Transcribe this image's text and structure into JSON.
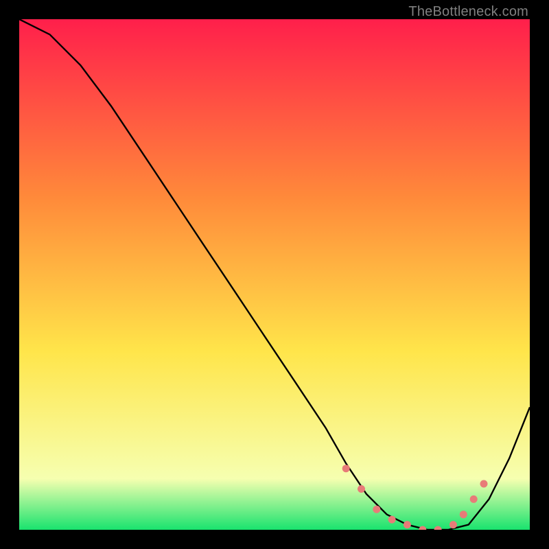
{
  "attribution": "TheBottleneck.com",
  "colors": {
    "gradient_top": "#ff1f4b",
    "gradient_mid_high": "#ff8a3a",
    "gradient_mid": "#ffe54a",
    "gradient_low": "#f6ffb0",
    "gradient_bottom": "#19e36e",
    "curve": "#000000",
    "markers": "#e87b78",
    "frame": "#000000"
  },
  "chart_data": {
    "type": "line",
    "title": "",
    "xlabel": "",
    "ylabel": "",
    "xlim": [
      0,
      100
    ],
    "ylim": [
      0,
      100
    ],
    "series": [
      {
        "name": "curve",
        "x": [
          0,
          6,
          12,
          18,
          24,
          30,
          36,
          42,
          48,
          54,
          60,
          64,
          68,
          72,
          76,
          80,
          84,
          88,
          92,
          96,
          100
        ],
        "y": [
          100,
          97,
          91,
          83,
          74,
          65,
          56,
          47,
          38,
          29,
          20,
          13,
          7,
          3,
          1,
          0,
          0,
          1,
          6,
          14,
          24
        ]
      }
    ],
    "markers": {
      "name": "highlight-points",
      "x": [
        64,
        67,
        70,
        73,
        76,
        79,
        82,
        85,
        87,
        89,
        91
      ],
      "y": [
        12,
        8,
        4,
        2,
        1,
        0,
        0,
        1,
        3,
        6,
        9
      ]
    }
  }
}
